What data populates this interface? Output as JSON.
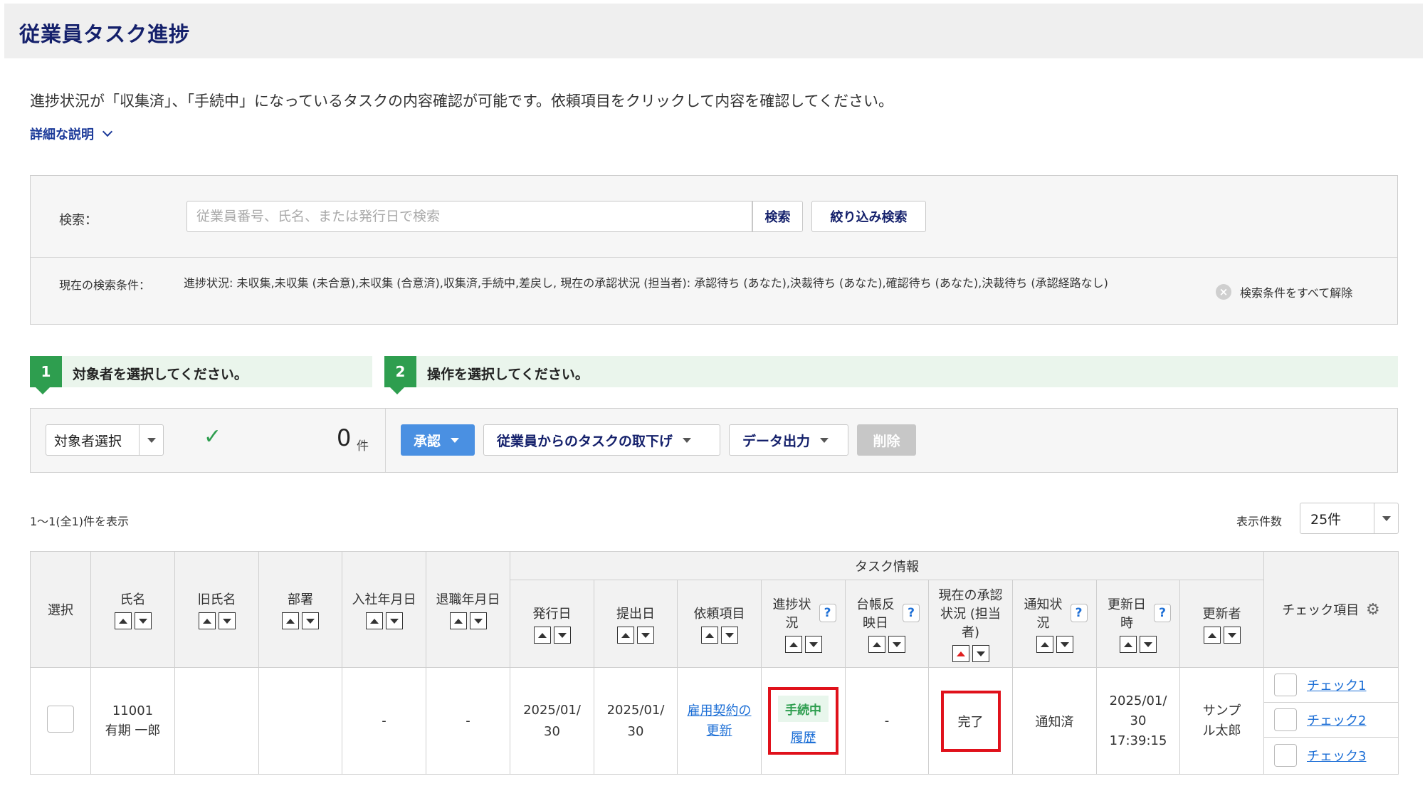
{
  "header": {
    "title": "従業員タスク進捗"
  },
  "description": "進捗状況が「収集済」、「手続中」になっているタスクの内容確認が可能です。依頼項目をクリックして内容を確認してください。",
  "detail_link": "詳細な説明",
  "search": {
    "label": "検索：",
    "placeholder": "従業員番号、氏名、または発行日で検索",
    "value": "",
    "search_button": "検索",
    "filter_button": "絞り込み検索",
    "conditions_label": "現在の検索条件：",
    "conditions_text": "進捗状況: 未収集,未収集 (未合意),未収集 (合意済),収集済,手続中,差戻し, 現在の承認状況 (担当者): 承認待ち (あなた),決裁待ち (あなた),確認待ち (あなた),決裁待ち (承認経路なし)",
    "clear_all": "検索条件をすべて解除"
  },
  "steps": [
    {
      "num": "1",
      "text": "対象者を選択してください。"
    },
    {
      "num": "2",
      "text": "操作を選択してください。"
    }
  ],
  "actions": {
    "select_target": "対象者選択",
    "selected_count": "0",
    "count_unit": "件",
    "approve": "承認",
    "withdraw": "従業員からのタスクの取下げ",
    "export": "データ出力",
    "delete": "削除"
  },
  "list": {
    "showing": "1〜1(全1)件を表示",
    "per_page_label": "表示件数",
    "per_page_value": "25件"
  },
  "table": {
    "group_header": "タスク情報",
    "headers": {
      "select": "選択",
      "name": "氏名",
      "old_name": "旧氏名",
      "department": "部署",
      "join_date": "入社年月日",
      "leave_date": "退職年月日",
      "issue_date": "発行日",
      "submit_date": "提出日",
      "request_item": "依頼項目",
      "progress": "進捗状況",
      "ledger_date": "台帳反映日",
      "approval_status": "現在の承認状況 (担当者)",
      "notice_status": "通知状況",
      "updated_at": "更新日時",
      "updater": "更新者",
      "check_items": "チェック項目"
    },
    "rows": [
      {
        "employee_no": "11001",
        "name": "有期 一郎",
        "old_name": "",
        "department": "",
        "join_date": "-",
        "leave_date": "-",
        "issue_date": "2025/01/30",
        "submit_date": "2025/01/30",
        "request_item": "雇用契約の更新",
        "progress_status": "手続中",
        "history_link": "履歴",
        "ledger_date": "-",
        "approval_status": "完了",
        "notice_status": "通知済",
        "updated_date": "2025/01/30",
        "updated_time": "17:39:15",
        "updater": "サンプル太郎",
        "checks": [
          "チェック1",
          "チェック2",
          "チェック3"
        ]
      }
    ]
  },
  "colors": {
    "accent": "#4a90e2",
    "step_green": "#2e9e4f",
    "highlight_red": "#e0111b",
    "title_navy": "#14206b"
  }
}
